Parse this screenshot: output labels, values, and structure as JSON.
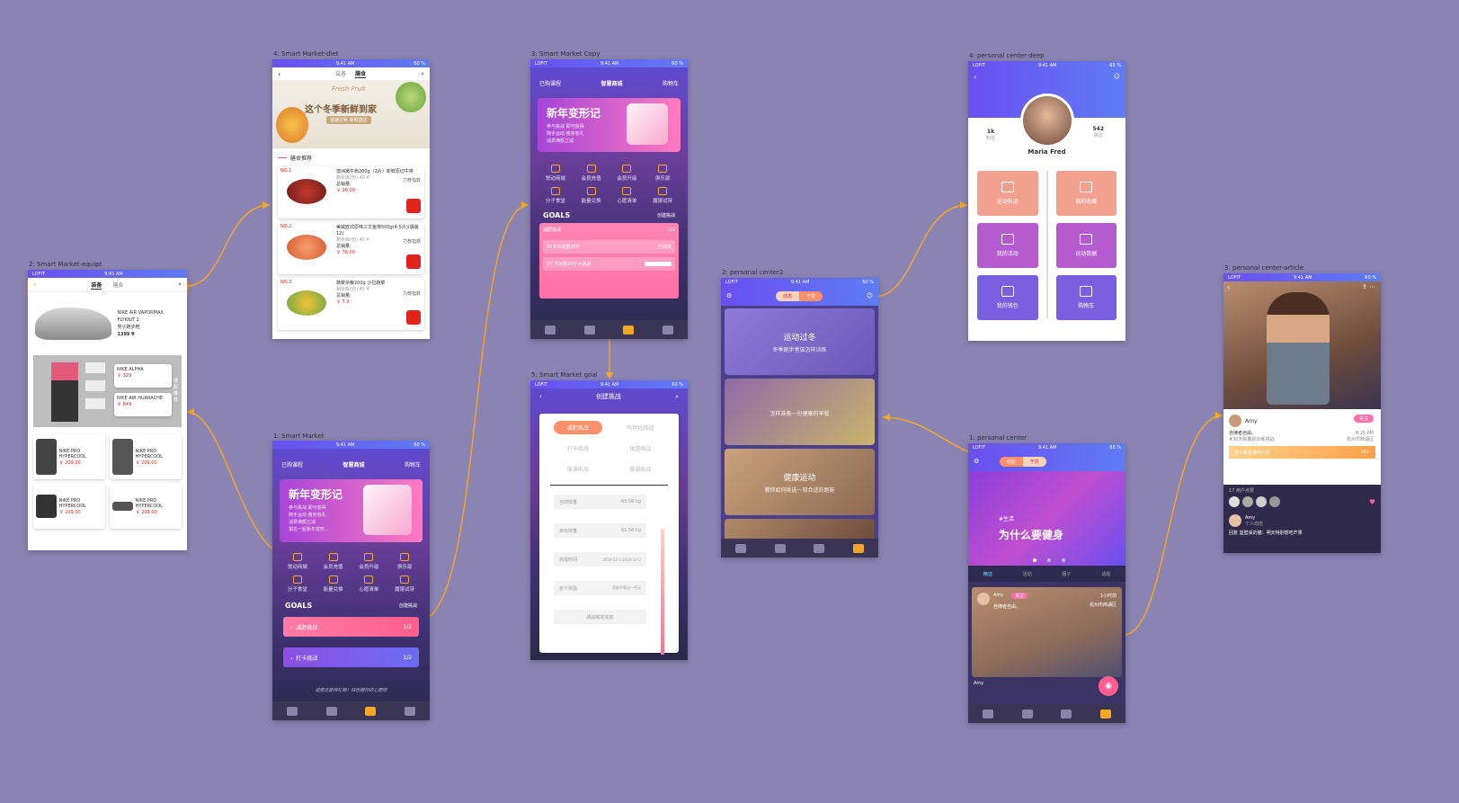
{
  "screens": {
    "equip": {
      "title": "2: Smart Market-equipt",
      "status": {
        "carrier": "LOFIT",
        "time": "9:41 AM"
      },
      "tabs": [
        "装备",
        "膳食"
      ],
      "hero": {
        "name": "NIKE AIR VAPORMAX FLYKNIT 2",
        "sub": "男子跑步鞋",
        "price": "1399 ¥"
      },
      "side_label": "搭配推荐",
      "mini": [
        {
          "name": "NIKE ALPHA",
          "count": "已申请",
          "price": "￥ 329"
        },
        {
          "name": "NIKE AIR HUARACHE",
          "count": "已申请",
          "price": "￥ 849"
        }
      ],
      "grid": [
        {
          "name": "NIKE PRO HYPERCOOL",
          "price": "￥ 209.00"
        },
        {
          "name": "NIKE PRO HYPERCOOL",
          "price": "￥ 209.00"
        },
        {
          "name": "NIKE PRO HYPERCOOL",
          "price": "￥ 209.00"
        },
        {
          "name": "NIKE PRO HYPERCOOL",
          "price": "￥ 209.00"
        }
      ]
    },
    "diet": {
      "title": "4: Smart Market-diet",
      "status": {
        "carrier": "",
        "time": "9:41 AM",
        "battery": "60 %"
      },
      "tabs": [
        "装备",
        "膳食"
      ],
      "banner": {
        "en": "Fresh Fruit",
        "cn": "这个冬季新鲜到家",
        "sub": "速速订购 新鲜直达"
      },
      "section": "膳食推荐",
      "items": [
        {
          "rank": "NO.1",
          "name": "澳洲嫩牛肩200g（2片）新鲜原切牛排",
          "meta": "剩余库(份) 40 ¥",
          "sales": "总销量:",
          "fit": "力荐指数",
          "price": "￥ 26.00"
        },
        {
          "rank": "NO.2",
          "name": "美威欧式原味三文鱼排500g(4-5片)(袋装12)",
          "meta": "剩余库(份) 40 ¥",
          "sales": "总销量:",
          "fit": "力荐指数",
          "price": "￥ 76.00"
        },
        {
          "rank": "NO.3",
          "name": "蔬菜杂粮200g 沙拉蔬菜",
          "meta": "剩余库(份) 40 ¥",
          "sales": "总销量:",
          "fit": "力荐指数",
          "price": "￥ 7.9"
        }
      ]
    },
    "copy": {
      "title": "3: Smart Market Copy",
      "status": {
        "carrier": "LOFIT",
        "time": "9:41 AM",
        "battery": "60 %"
      },
      "header": {
        "left": "已购课程",
        "center": "智慧商城",
        "right": "购物车"
      },
      "banner": {
        "title": "新年变形记",
        "lines": [
          "参与挑战 即可获得",
          "随手运动 瘦身有礼",
          "消费满额立减",
          "报名一起新年变形..."
        ]
      },
      "menu": [
        "悦动商城",
        "会员充值",
        "会员升级",
        "俱乐部",
        "分子食堂",
        "能量兑换",
        "心愿清单",
        "魔镜试穿"
      ],
      "goals": "GOALS",
      "create": "创建挑战",
      "challenge": {
        "name": "减肥挑战",
        "count": "1/2",
        "row1": "20天内减重20斤",
        "row1_btn": "已完成",
        "row2": "3个月减重20斤大挑战"
      }
    },
    "goal": {
      "title": "5: Smart Market goal",
      "status": {
        "carrier": "LOFIT",
        "time": "9:41 AM",
        "battery": "60 %"
      },
      "header": "创建挑战",
      "types": [
        "减肥挑战",
        "马甲线挑战",
        "打卡挑战",
        "体脂挑战",
        "操课挑战",
        "操课挑战"
      ],
      "fields": [
        {
          "label": "当前体重",
          "value": "69.56",
          "unit": "kg"
        },
        {
          "label": "目标体重",
          "value": "61.56",
          "unit": "kg"
        },
        {
          "label": "完成时间",
          "value": "2018-12-1-2018-12-2",
          "unit": ""
        },
        {
          "label": "定个奖励",
          "value": "奖励不超过一百元",
          "unit": ""
        }
      ],
      "submit": "挑战制定完成"
    },
    "market": {
      "title": "1: Smart Market",
      "status": {
        "carrier": "",
        "time": "9:41 AM",
        "battery": "60 %"
      },
      "header": {
        "left": "已购课程",
        "center": "智慧商城",
        "right": "购物车"
      },
      "banner": {
        "title": "新年变形记",
        "lines": [
          "参与挑战 即可获得",
          "随手运动 瘦身有礼",
          "消费满额立减",
          "报名一起新年变形..."
        ]
      },
      "menu": [
        "悦动商城",
        "会员充值",
        "会员升级",
        "俱乐部",
        "分子食堂",
        "能量兑换",
        "心愿清单",
        "魔镜试穿"
      ],
      "goals": "GOALS",
      "create": "创建挑战",
      "challenges": [
        {
          "name": "减肥挑战",
          "count": "1/2"
        },
        {
          "name": "打卡挑战",
          "count": "1/2"
        }
      ],
      "footer": "减肥达能得礼物！快创建你的心愿吧"
    },
    "pc2": {
      "title": "2: personal center2",
      "status": {
        "carrier": "LOFIT",
        "time": "9:41 AM",
        "battery": "60 %"
      },
      "toggle": [
        "动态",
        "干货"
      ],
      "cards": [
        {
          "title": "运动过冬",
          "sub": "冬季跑步者该怎样训练"
        },
        {
          "title": "",
          "sub": "怎样准备一份健康的早餐"
        },
        {
          "title": "健康运动",
          "sub": "教你如何挑选一双合适的跑鞋"
        }
      ]
    },
    "deep": {
      "title": "4: personal center-deep",
      "status": {
        "carrier": "LOFIT",
        "time": "9:41 AM",
        "battery": "60 %"
      },
      "followers": {
        "value": "1k",
        "label": "粉丝"
      },
      "following": {
        "value": "542",
        "label": "关注"
      },
      "name": "Maria Fred",
      "tiles": [
        {
          "label": "运动轨迹",
          "color": "#f2a08f"
        },
        {
          "label": "我的收藏",
          "color": "#f2a08f"
        },
        {
          "label": "我的活动",
          "color": "#b45bd0"
        },
        {
          "label": "运动数据",
          "color": "#b45bd0"
        },
        {
          "label": "我的钱包",
          "color": "#7a5ee0"
        },
        {
          "label": "购物车",
          "color": "#7a5ee0"
        }
      ]
    },
    "article": {
      "title": "3: personal center-article",
      "status": {
        "carrier": "LOFIT",
        "time": "9:41 AM",
        "battery": "60 %"
      },
      "post": {
        "name": "Amy",
        "tag": "关注",
        "text": "自律者自由。",
        "sub": "#30天新腹肌训练挑战",
        "time": "8:25 PM",
        "loc": "杭州市西湖区"
      },
      "location": "浙大紫金港中心区",
      "location_right": "30+",
      "comment_head": "17 用户点赞",
      "comment": {
        "name": "Amy",
        "sub": "个人动态",
        "text": "回复 篮壁桌的猫：明天特别想吃芒果"
      }
    },
    "pc": {
      "title": "1: personal center",
      "status": {
        "carrier": "LOFIT",
        "time": "9:41 AM",
        "battery": "60 %"
      },
      "toggle": [
        "动态",
        "干货"
      ],
      "hero": {
        "tag": "#生活",
        "title": "为什么要健身"
      },
      "tabs": [
        "精选",
        "活动",
        "圈子",
        "话题"
      ],
      "post": {
        "name": "Amy",
        "tag": "关注",
        "text": "自律者自由。",
        "time": "1小时前",
        "loc": "杭州市西湖区"
      },
      "next": "Amy"
    }
  },
  "colors": {
    "background": "#8b84b3",
    "wire": "#f5a623",
    "accent": "#f5a623",
    "purple": "#5d4bd3",
    "pink": "#ff6fa8",
    "red": "#e2231a"
  }
}
